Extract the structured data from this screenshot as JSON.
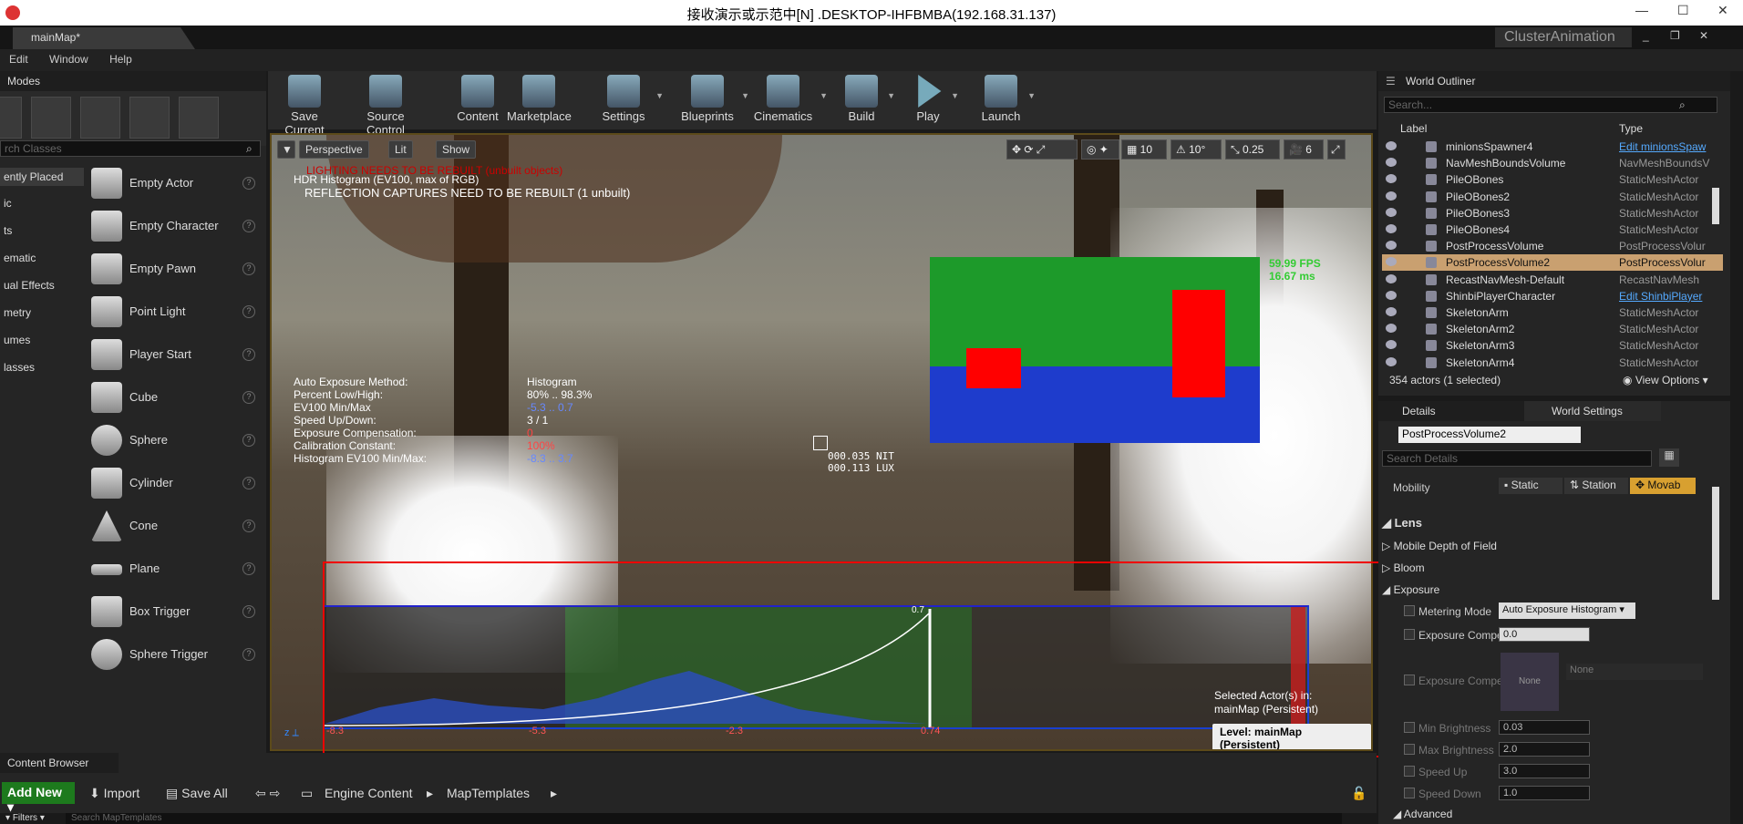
{
  "remote_title": "接收演示或示范中[N] .DESKTOP-IHFBMBA(192.168.31.137)",
  "ue": {
    "tab": "mainMap*",
    "project": "ClusterAnimation",
    "menu": [
      "Edit",
      "Window",
      "Help"
    ]
  },
  "modes": {
    "title": "Modes",
    "search_placeholder": "rch Classes",
    "categories": [
      "ently Placed",
      "ic",
      "ts",
      "ematic",
      "ual Effects",
      "metry",
      "umes",
      "lasses"
    ],
    "items": [
      "Empty Actor",
      "Empty Character",
      "Empty Pawn",
      "Point Light",
      "Player Start",
      "Cube",
      "Sphere",
      "Cylinder",
      "Cone",
      "Plane",
      "Box Trigger",
      "Sphere Trigger"
    ]
  },
  "toolbar": [
    "Save Current",
    "Source Control",
    "Content",
    "Marketplace",
    "Settings",
    "Blueprints",
    "Cinematics",
    "Build",
    "Play",
    "Launch"
  ],
  "viewport": {
    "perspective": "Perspective",
    "lit": "Lit",
    "show": "Show",
    "grid": "10",
    "rot": "10°",
    "scale": "0.25",
    "cam": "6",
    "msg_lighting": "LIGHTING NEEDS TO BE REBUILT (unbuilt objects)",
    "msg_hdr": "HDR Histogram (EV100, max of RGB)",
    "msg_reflection": "REFLECTION CAPTURES NEED TO BE REBUILT (1 unbuilt)",
    "exposure": [
      {
        "label": "Auto Exposure Method:",
        "value": "Histogram",
        "color": "#ffffff"
      },
      {
        "label": "Percent Low/High:",
        "value": "80% .. 98.3%",
        "color": "#ffffff"
      },
      {
        "label": "EV100 Min/Max",
        "value": "-5.3 .. 0.7",
        "color": "#6688ff"
      },
      {
        "label": "Speed Up/Down:",
        "value": "3 / 1",
        "color": "#ffffff"
      },
      {
        "label": "Exposure Compensation:",
        "value": "0",
        "color": "#ff4444"
      },
      {
        "label": "Calibration Constant:",
        "value": "100%",
        "color": "#ff4444"
      },
      {
        "label": "Histogram EV100 Min/Max:",
        "value": "-8.3 .. 3.7",
        "color": "#6688ff"
      }
    ],
    "fps": "59.99 FPS",
    "ms": "16.67 ms",
    "nit": "000.035 NIT",
    "lux": "000.113 LUX",
    "hist_labels": [
      "-8.3",
      "-5.3",
      "-2.3",
      "0.74"
    ],
    "hist_marker": "0.7",
    "selected_line1": "Selected Actor(s) in:",
    "selected_line2": "mainMap (Persistent)",
    "level": "Level:  mainMap (Persistent)"
  },
  "outliner": {
    "title": "World Outliner",
    "search_placeholder": "Search...",
    "col_label": "Label",
    "col_type": "Type",
    "rows": [
      {
        "label": "minionsSpawner4",
        "type": "Edit minionsSpaw",
        "link": true
      },
      {
        "label": "NavMeshBoundsVolume",
        "type": "NavMeshBoundsV",
        "link": false
      },
      {
        "label": "PileOBones",
        "type": "StaticMeshActor",
        "link": false
      },
      {
        "label": "PileOBones2",
        "type": "StaticMeshActor",
        "link": false
      },
      {
        "label": "PileOBones3",
        "type": "StaticMeshActor",
        "link": false
      },
      {
        "label": "PileOBones4",
        "type": "StaticMeshActor",
        "link": false
      },
      {
        "label": "PostProcessVolume",
        "type": "PostProcessVolur",
        "link": false
      },
      {
        "label": "PostProcessVolume2",
        "type": "PostProcessVolur",
        "link": false,
        "selected": true
      },
      {
        "label": "RecastNavMesh-Default",
        "type": "RecastNavMesh",
        "link": false
      },
      {
        "label": "ShinbiPlayerCharacter",
        "type": "Edit ShinbiPlayer",
        "link": true
      },
      {
        "label": "SkeletonArm",
        "type": "StaticMeshActor",
        "link": false
      },
      {
        "label": "SkeletonArm2",
        "type": "StaticMeshActor",
        "link": false
      },
      {
        "label": "SkeletonArm3",
        "type": "StaticMeshActor",
        "link": false
      },
      {
        "label": "SkeletonArm4",
        "type": "StaticMeshActor",
        "link": false
      }
    ],
    "count": "354 actors (1 selected)",
    "view_options": "View Options"
  },
  "details": {
    "tab1": "Details",
    "tab2": "World Settings",
    "name": "PostProcessVolume2",
    "search_placeholder": "Search Details",
    "mobility_label": "Mobility",
    "mobility": [
      "Static",
      "Station",
      "Movab"
    ],
    "lens": "Lens",
    "sections": [
      "Mobile Depth of Field",
      "Bloom",
      "Exposure"
    ],
    "metering_label": "Metering Mode",
    "metering_value": "Auto Exposure Histogram",
    "exp_comp_label": "Exposure Compe",
    "exp_comp_value": "0.0",
    "exp_curve_label": "Exposure Compe",
    "none_thumb": "None",
    "none_value": "None",
    "min_brightness_label": "Min Brightness",
    "min_brightness": "0.03",
    "max_brightness_label": "Max Brightness",
    "max_brightness": "2.0",
    "speed_up_label": "Speed Up",
    "speed_up": "3.0",
    "speed_down_label": "Speed Down",
    "speed_down": "1.0",
    "advanced": "Advanced"
  },
  "content_browser": {
    "title": "Content Browser",
    "add_new": "Add New",
    "import": "Import",
    "save_all": "Save All",
    "path1": "Engine Content",
    "path2": "MapTemplates",
    "filters": "Filters",
    "search_placeholder": "Search MapTemplates"
  }
}
